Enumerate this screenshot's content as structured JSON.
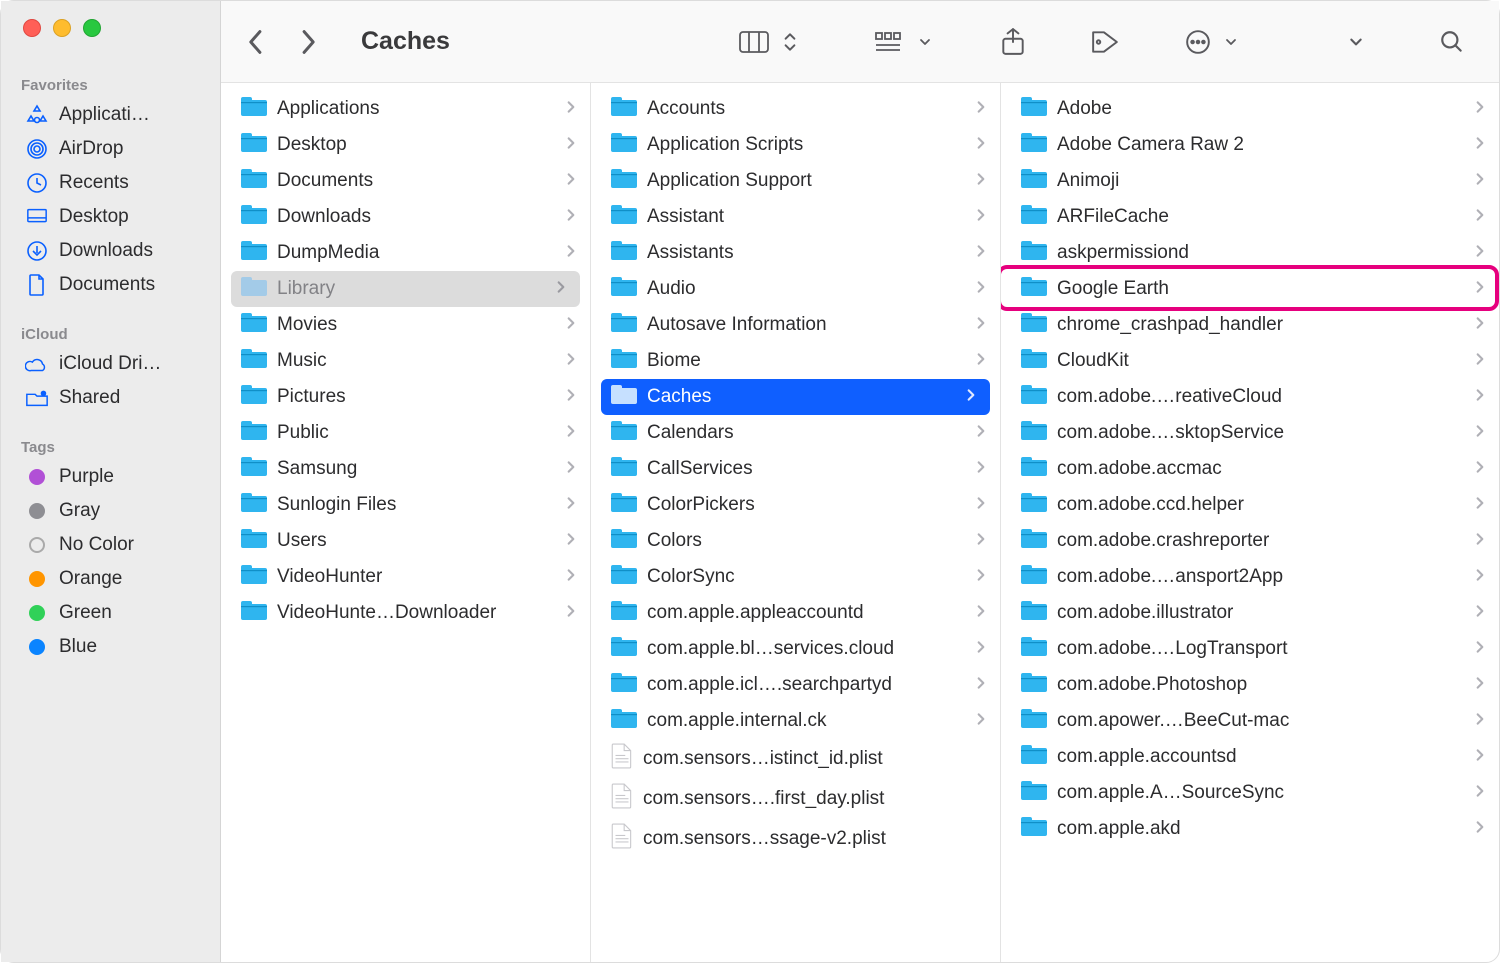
{
  "window": {
    "title": "Caches"
  },
  "sidebar": {
    "sections": [
      {
        "label": "Favorites",
        "items": [
          {
            "icon": "app-grid-icon",
            "label": "Applicati…"
          },
          {
            "icon": "airdrop-icon",
            "label": "AirDrop"
          },
          {
            "icon": "clock-icon",
            "label": "Recents"
          },
          {
            "icon": "desktop-icon",
            "label": "Desktop"
          },
          {
            "icon": "download-icon",
            "label": "Downloads"
          },
          {
            "icon": "document-icon",
            "label": "Documents"
          }
        ]
      },
      {
        "label": "iCloud",
        "items": [
          {
            "icon": "cloud-icon",
            "label": "iCloud Dri…"
          },
          {
            "icon": "shared-icon",
            "label": "Shared"
          }
        ]
      },
      {
        "label": "Tags",
        "items": [
          {
            "icon": "tag-dot",
            "color": "#b150d6",
            "label": "Purple"
          },
          {
            "icon": "tag-dot",
            "color": "#8e8e93",
            "label": "Gray"
          },
          {
            "icon": "tag-dot",
            "color": "",
            "label": "No Color"
          },
          {
            "icon": "tag-dot",
            "color": "#ff9500",
            "label": "Orange"
          },
          {
            "icon": "tag-dot",
            "color": "#30d158",
            "label": "Green"
          },
          {
            "icon": "tag-dot",
            "color": "#0a84ff",
            "label": "Blue"
          }
        ]
      }
    ]
  },
  "toolbar": {
    "buttons": [
      "columns-view",
      "view-picker",
      "grid-view",
      "share",
      "tag",
      "action-menu",
      "dropdown",
      "search"
    ]
  },
  "columns": [
    {
      "items": [
        {
          "type": "folder",
          "name": "Applications"
        },
        {
          "type": "folder",
          "name": "Desktop"
        },
        {
          "type": "folder",
          "name": "Documents"
        },
        {
          "type": "folder",
          "name": "Downloads"
        },
        {
          "type": "folder",
          "name": "DumpMedia"
        },
        {
          "type": "folder",
          "name": "Library",
          "selected": "gray"
        },
        {
          "type": "folder",
          "name": "Movies"
        },
        {
          "type": "folder",
          "name": "Music"
        },
        {
          "type": "folder",
          "name": "Pictures"
        },
        {
          "type": "folder",
          "name": "Public"
        },
        {
          "type": "folder",
          "name": "Samsung"
        },
        {
          "type": "folder",
          "name": "Sunlogin Files"
        },
        {
          "type": "folder",
          "name": "Users"
        },
        {
          "type": "folder",
          "name": "VideoHunter"
        },
        {
          "type": "folder",
          "name": "VideoHunte…Downloader"
        }
      ]
    },
    {
      "items": [
        {
          "type": "folder",
          "name": "Accounts"
        },
        {
          "type": "folder",
          "name": "Application Scripts"
        },
        {
          "type": "folder",
          "name": "Application Support"
        },
        {
          "type": "folder",
          "name": "Assistant"
        },
        {
          "type": "folder",
          "name": "Assistants"
        },
        {
          "type": "folder",
          "name": "Audio"
        },
        {
          "type": "folder",
          "name": "Autosave Information"
        },
        {
          "type": "folder",
          "name": "Biome"
        },
        {
          "type": "folder",
          "name": "Caches",
          "selected": "blue"
        },
        {
          "type": "folder",
          "name": "Calendars"
        },
        {
          "type": "folder",
          "name": "CallServices"
        },
        {
          "type": "folder",
          "name": "ColorPickers"
        },
        {
          "type": "folder",
          "name": "Colors"
        },
        {
          "type": "folder",
          "name": "ColorSync"
        },
        {
          "type": "folder",
          "name": "com.apple.appleaccountd"
        },
        {
          "type": "folder",
          "name": "com.apple.bl…services.cloud"
        },
        {
          "type": "folder",
          "name": "com.apple.icl….searchpartyd"
        },
        {
          "type": "folder",
          "name": "com.apple.internal.ck"
        },
        {
          "type": "file",
          "name": "com.sensors…istinct_id.plist"
        },
        {
          "type": "file",
          "name": "com.sensors….first_day.plist"
        },
        {
          "type": "file",
          "name": "com.sensors…ssage-v2.plist"
        }
      ]
    },
    {
      "items": [
        {
          "type": "folder",
          "name": "Adobe"
        },
        {
          "type": "folder",
          "name": "Adobe Camera Raw 2"
        },
        {
          "type": "folder",
          "name": "Animoji"
        },
        {
          "type": "folder",
          "name": "ARFileCache"
        },
        {
          "type": "folder",
          "name": "askpermissiond"
        },
        {
          "type": "folder",
          "name": "Google Earth",
          "highlight": true
        },
        {
          "type": "folder",
          "name": "chrome_crashpad_handler"
        },
        {
          "type": "folder",
          "name": "CloudKit"
        },
        {
          "type": "folder",
          "name": "com.adobe.…reativeCloud"
        },
        {
          "type": "folder",
          "name": "com.adobe.…sktopService"
        },
        {
          "type": "folder",
          "name": "com.adobe.accmac"
        },
        {
          "type": "folder",
          "name": "com.adobe.ccd.helper"
        },
        {
          "type": "folder",
          "name": "com.adobe.crashreporter"
        },
        {
          "type": "folder",
          "name": "com.adobe.…ansport2App"
        },
        {
          "type": "folder",
          "name": "com.adobe.illustrator"
        },
        {
          "type": "folder",
          "name": "com.adobe.…LogTransport"
        },
        {
          "type": "folder",
          "name": "com.adobe.Photoshop"
        },
        {
          "type": "folder",
          "name": "com.apower.…BeeCut-mac"
        },
        {
          "type": "folder",
          "name": "com.apple.accountsd"
        },
        {
          "type": "folder",
          "name": "com.apple.A…SourceSync"
        },
        {
          "type": "folder",
          "name": "com.apple.akd"
        }
      ]
    }
  ]
}
